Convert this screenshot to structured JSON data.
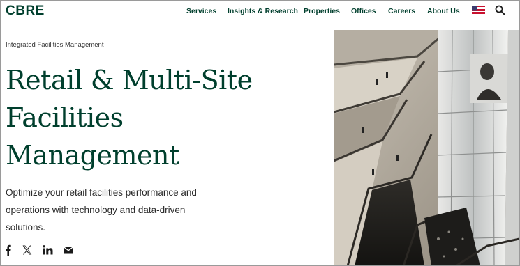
{
  "header": {
    "logo_text": "CBRE",
    "nav": [
      {
        "label": "Services"
      },
      {
        "label": "Insights & Research"
      },
      {
        "label": "Properties"
      },
      {
        "label": "Offices"
      },
      {
        "label": "Careers"
      },
      {
        "label": "About Us"
      }
    ],
    "flag_icon": "us-flag-icon",
    "search_icon": "search-icon"
  },
  "hero": {
    "eyebrow": "Integrated Facilities Management",
    "title_lines": [
      "Retail & Multi-Site",
      "Facilities",
      "Management"
    ],
    "description_lines": [
      "Optimize your retail facilities performance and",
      "operations with technology and data-driven",
      "solutions."
    ]
  },
  "share": [
    {
      "icon": "facebook-icon"
    },
    {
      "icon": "x-twitter-icon"
    },
    {
      "icon": "linkedin-icon"
    },
    {
      "icon": "email-icon"
    }
  ],
  "colors": {
    "brand_green": "#003f2d",
    "text": "#2b2b2b"
  }
}
